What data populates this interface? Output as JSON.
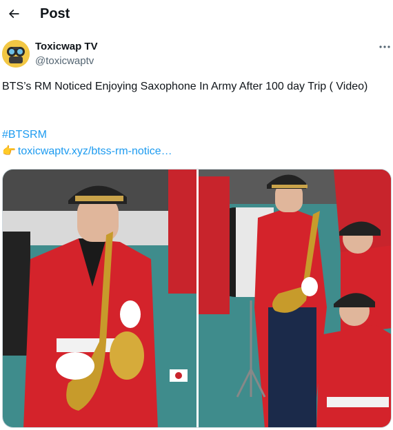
{
  "header": {
    "title": "Post"
  },
  "author": {
    "name": "Toxicwap TV",
    "handle": "@toxicwaptv"
  },
  "tweet": {
    "text": "BTS’s RM Noticed Enjoying Saxophone In Army After 100 day Trip ( Video)",
    "hashtag": "#BTSRM",
    "link_emoji": "👉",
    "link_text": "toxicwaptv.xyz/btss-rm-notice…"
  },
  "colors": {
    "accent": "#1d9bf0",
    "muted": "#536471"
  },
  "icons": {
    "back": "arrow-left-icon",
    "more": "more-dots-icon"
  }
}
